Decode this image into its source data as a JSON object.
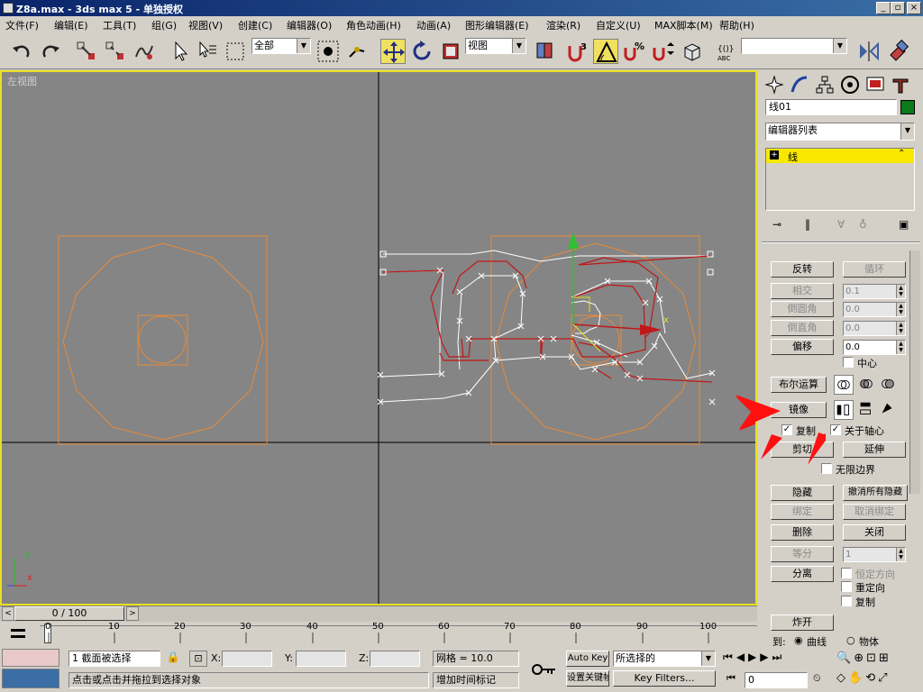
{
  "window": {
    "title": "Z8a.max - 3ds max 5 - 单独授权",
    "min": "_",
    "max": "▫",
    "close": "×"
  },
  "menu": [
    "文件(F)",
    "编辑(E)",
    "工具(T)",
    "组(G)",
    "视图(V)",
    "创建(C)",
    "编辑器(O)",
    "角色动画(H)",
    "动画(A)",
    "图形编辑器(E)",
    "渲染(R)",
    "自定义(U)",
    "MAX脚本(M)",
    "帮助(H)"
  ],
  "toolbar": {
    "selection_filter": "全部",
    "ref_coord": "视图",
    "named_selection": ""
  },
  "viewport": {
    "label": "左视图",
    "axis_z": "z",
    "axis_x": "x",
    "gizmo_x": "x"
  },
  "panel": {
    "object_name": "线01",
    "modifier_list": "编辑器列表",
    "stack_item": "线",
    "stack_plus": "+",
    "buttons": {
      "reverse": "反转",
      "cycle": "循环",
      "intersect": "相交",
      "fillet": "倒圆角",
      "chamfer": "倒直角",
      "offset": "偏移",
      "boolean": "布尔运算",
      "mirror": "镜像",
      "trim": "剪切",
      "extend": "延伸",
      "hide": "隐藏",
      "unhide_all": "撤消所有隐藏",
      "bind": "绑定",
      "unbind": "取消绑定",
      "delete": "删除",
      "close": "关闭",
      "divide": "等分",
      "detach": "分离",
      "explode": "炸开"
    },
    "spinners": {
      "intersect": "0.1",
      "fillet": "0.0",
      "chamfer": "0.0",
      "offset": "0.0",
      "divide": "1"
    },
    "checks": {
      "center": "中心",
      "copy": "复制",
      "about_pivot": "关于轴心",
      "infinite_bounds": "无限边界",
      "same_shape": "恒定方向",
      "reorient": "重定向",
      "copy2": "复制"
    },
    "explode_options": {
      "to_label": "到:",
      "splines": "曲线",
      "objects": "物体"
    }
  },
  "time": {
    "slider": "0 / 100",
    "ticks": [
      "0",
      "10",
      "20",
      "30",
      "40",
      "50",
      "60",
      "70",
      "80",
      "90",
      "100"
    ]
  },
  "status": {
    "selection": "1 截面被选择",
    "x_label": "X:",
    "y_label": "Y:",
    "z_label": "Z:",
    "x_value": "",
    "y_value": "",
    "z_value": "",
    "grid": "网格 = 10.0",
    "prompt": "点击或点击并拖拉到选择对象",
    "add_time_tag": "增加时间标记",
    "auto_key": "Auto Key",
    "set_key": "设置关键帧",
    "key_filter_combo": "所选择的",
    "key_filters": "Key Filters...",
    "frame": "0"
  }
}
